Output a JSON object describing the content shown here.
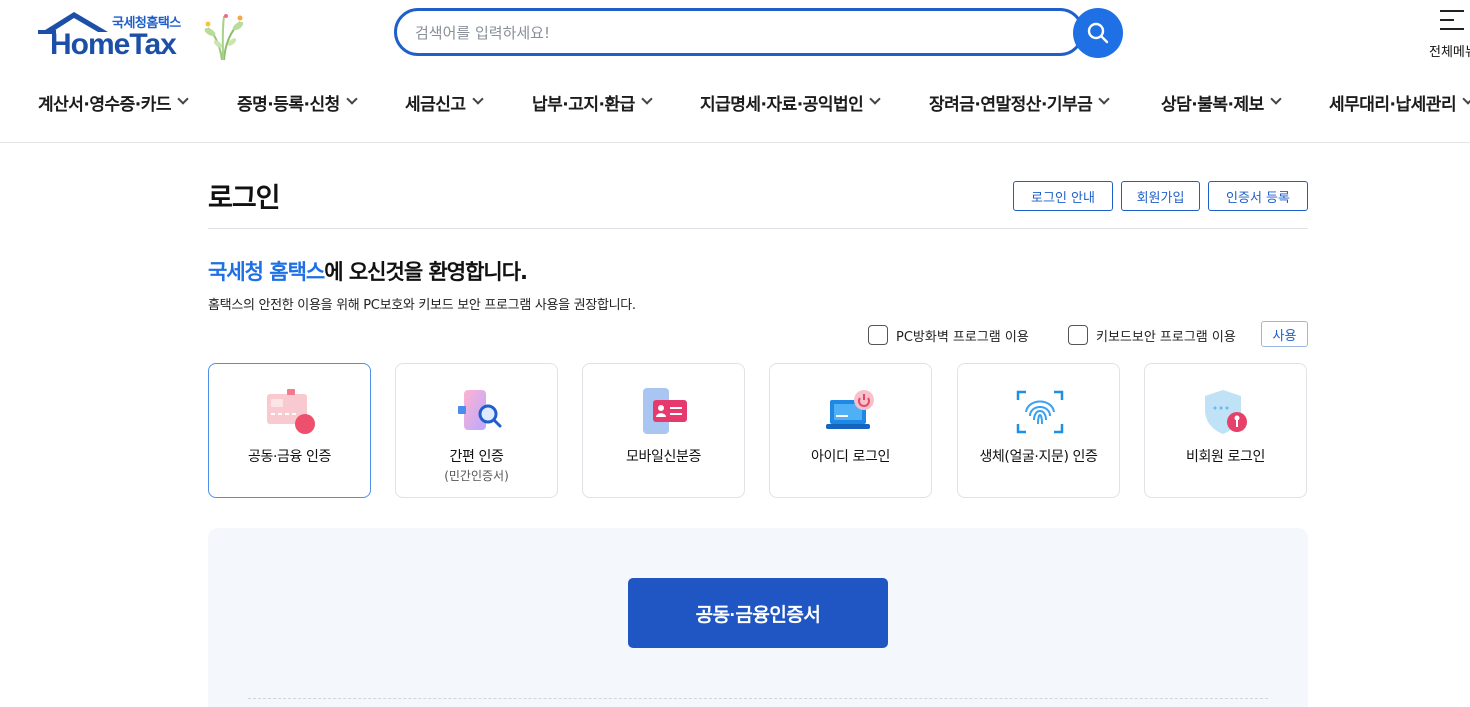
{
  "header": {
    "logo_sub": "국세청홈택스",
    "logo_main": "HomeTax",
    "search_placeholder": "검색어를 입력하세요!",
    "search_icon": "search-icon",
    "allmenu_icon": "hamburger-icon",
    "allmenu_label": "전체메뉴"
  },
  "gnb": [
    {
      "label": "계산서·영수증·카드"
    },
    {
      "label": "증명·등록·신청"
    },
    {
      "label": "세금신고"
    },
    {
      "label": "납부·고지·환급"
    },
    {
      "label": "지급명세·자료·공익법인"
    },
    {
      "label": "장려금·연말정산·기부금"
    },
    {
      "label": "상담·불복·제보"
    },
    {
      "label": "세무대리·납세관리"
    }
  ],
  "main": {
    "title": "로그인",
    "buttons": {
      "guide": "로그인 안내",
      "join": "회원가입",
      "cert_register": "인증서 등록"
    },
    "welcome_hl": "국세청 홈택스",
    "welcome_rest": "에 오신것을 환영합니다.",
    "desc": "홈택스의 안전한 이용을 위해 PC보호와 키보드 보안 프로그램 사용을 권장합니다.",
    "checks": {
      "firewall": "PC방화벽 프로그램 이용",
      "keyboard": "키보드보안 프로그램 이용"
    },
    "use_button": "사용",
    "methods": [
      {
        "label": "공동·금융 인증",
        "sub": "",
        "icon": "certificate-card-icon",
        "selected": true
      },
      {
        "label": "간편 인증",
        "sub": "(민간인증서)",
        "icon": "phone-search-icon",
        "selected": false
      },
      {
        "label": "모바일신분증",
        "sub": "",
        "icon": "mobile-id-icon",
        "selected": false
      },
      {
        "label": "아이디 로그인",
        "sub": "",
        "icon": "laptop-power-icon",
        "selected": false
      },
      {
        "label": "생체(얼굴·지문) 인증",
        "sub": "",
        "icon": "fingerprint-icon",
        "selected": false
      },
      {
        "label": "비회원 로그인",
        "sub": "",
        "icon": "shield-user-icon",
        "selected": false
      }
    ],
    "cert_button": "공동·금융인증서"
  },
  "colors": {
    "accent": "#1f5fc9",
    "button": "#1f56c3",
    "highlight": "#1f6fe5",
    "panel": "#f4f7fb"
  }
}
